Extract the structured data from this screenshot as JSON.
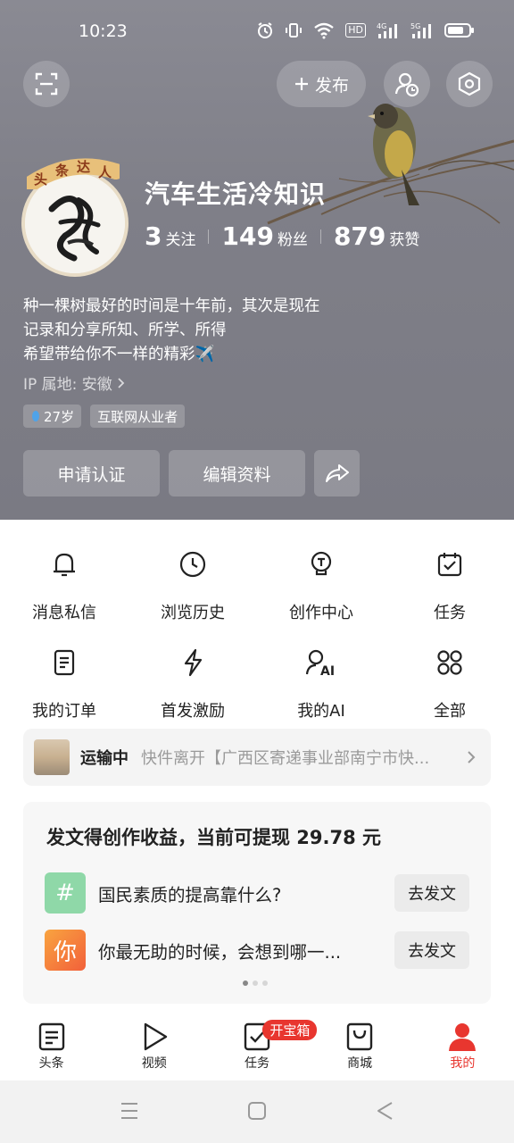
{
  "status": {
    "time": "10:23",
    "hd": "HD",
    "net1": "4G",
    "net2": "5G"
  },
  "header": {
    "publish_label": "发布"
  },
  "profile": {
    "badge_chars": [
      "头",
      "条",
      "达",
      "人"
    ],
    "name": "汽车生活冷知识",
    "stats": [
      {
        "num": "3",
        "label": "关注"
      },
      {
        "num": "149",
        "label": "粉丝"
      },
      {
        "num": "879",
        "label": "获赞"
      }
    ],
    "bio": [
      "种一棵树最好的时间是十年前，其次是现在",
      "记录和分享所知、所学、所得",
      "希望带给你不一样的精彩✈️"
    ],
    "ip": "IP 属地: 安徽",
    "tags": [
      "27岁",
      "互联网从业者"
    ],
    "apply_cert": "申请认证",
    "edit_profile": "编辑资料"
  },
  "grid": [
    {
      "label": "消息私信",
      "icon": "bell-icon"
    },
    {
      "label": "浏览历史",
      "icon": "clock-icon"
    },
    {
      "label": "创作中心",
      "icon": "bulb-icon"
    },
    {
      "label": "任务",
      "icon": "calendar-check-icon"
    },
    {
      "label": "我的订单",
      "icon": "order-icon"
    },
    {
      "label": "首发激励",
      "icon": "lightning-icon"
    },
    {
      "label": "我的AI",
      "icon": "ai-person-icon"
    },
    {
      "label": "全部",
      "icon": "grid-dots-icon"
    }
  ],
  "shipping": {
    "status": "运输中",
    "desc": "快件离开【广西区寄递事业部南宁市快..."
  },
  "earnings": {
    "title": "发文得创作收益，当前可提现 29.78 元",
    "items": [
      {
        "question": "国民素质的提高靠什么?",
        "icon_char": "#",
        "button": "去发文",
        "color": "#8fd8a8"
      },
      {
        "question": "你最无助的时候，会想到哪一...",
        "icon_char": "你",
        "button": "去发文",
        "color": "#f57f3d"
      }
    ]
  },
  "nav": [
    {
      "label": "头条",
      "icon": "news-icon"
    },
    {
      "label": "视频",
      "icon": "play-icon"
    },
    {
      "label": "任务",
      "icon": "task-icon",
      "badge": "开宝箱"
    },
    {
      "label": "商城",
      "icon": "shop-icon"
    },
    {
      "label": "我的",
      "icon": "profile-icon",
      "active": true
    }
  ],
  "colors": {
    "accent": "#e8362f",
    "hero_bg": "#808089"
  }
}
